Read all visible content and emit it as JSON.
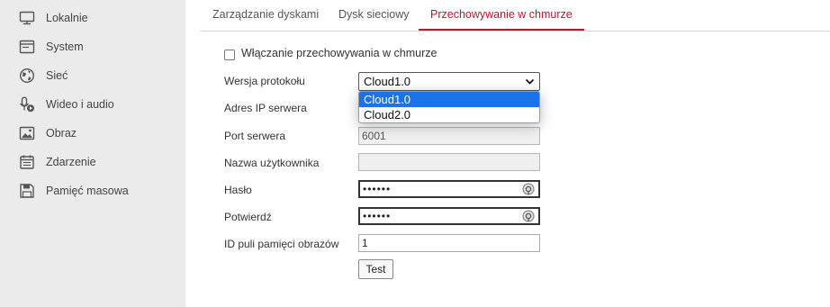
{
  "sidebar": {
    "items": [
      {
        "label": "Lokalnie",
        "icon": "monitor-icon"
      },
      {
        "label": "System",
        "icon": "window-icon"
      },
      {
        "label": "Sieć",
        "icon": "globe-icon"
      },
      {
        "label": "Wideo i audio",
        "icon": "microphone-play-icon"
      },
      {
        "label": "Obraz",
        "icon": "image-icon"
      },
      {
        "label": "Zdarzenie",
        "icon": "calendar-icon"
      },
      {
        "label": "Pamięć masowa",
        "icon": "floppy-disk-icon"
      }
    ]
  },
  "tabs": [
    {
      "label": "Zarządzanie dyskami",
      "active": false
    },
    {
      "label": "Dysk sieciowy",
      "active": false
    },
    {
      "label": "Przechowywanie w chmurze",
      "active": true
    }
  ],
  "form": {
    "enable_cloud": {
      "label": "Włączanie przechowywania w chmurze",
      "checked": false
    },
    "protocol": {
      "label": "Wersja protokołu",
      "value": "Cloud1.0",
      "options": [
        "Cloud1.0",
        "Cloud2.0"
      ],
      "selected": "Cloud1.0"
    },
    "server_ip": {
      "label": "Adres IP serwera",
      "value": ""
    },
    "server_port": {
      "label": "Port serwera",
      "value": "6001"
    },
    "username": {
      "label": "Nazwa użytkownika",
      "value": ""
    },
    "password": {
      "label": "Hasło",
      "value": "••••••"
    },
    "confirm": {
      "label": "Potwierdź",
      "value": "••••••"
    },
    "pool_id": {
      "label": "ID puli pamięci obrazów",
      "value": "1"
    },
    "test_button": "Test"
  },
  "colors": {
    "accent": "#c8102e",
    "sidebar_bg": "#ebebeb",
    "option_highlight": "#1a73e8"
  }
}
